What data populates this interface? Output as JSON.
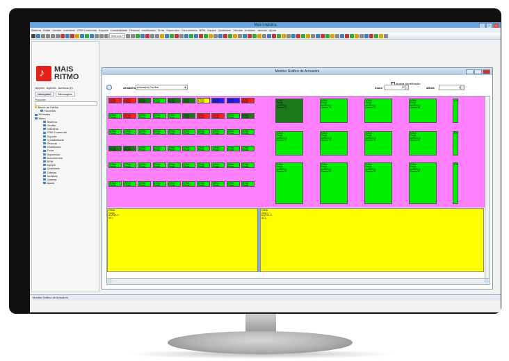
{
  "app": {
    "title": "Mais Logística"
  },
  "menu": [
    "Sistema",
    "Editar",
    "Gestão",
    "Industrial",
    "CRM Comercial",
    "Suporte",
    "Contabilidade",
    "Pessoal",
    "Imobilizado",
    "Frota",
    "Supervisor",
    "Documentos",
    "BPM",
    "Equipe",
    "Qualidade",
    "Tabelas",
    "Análises",
    "Janelas",
    "Ajuda"
  ],
  "toolbar": {
    "date_text": "Ano 2017"
  },
  "brand": {
    "line1": "MAIS",
    "line2": "RITMO",
    "red": "#e32119"
  },
  "leftpanel": {
    "tabs_top": [
      "Opções",
      "Agenda",
      "Acessos (0)"
    ],
    "tabs_bottom": [
      "Navegador",
      "Mensagens"
    ],
    "search_label": "Procurar :",
    "tree": [
      {
        "label": "Bases de Dados",
        "level": 1,
        "icon": "star-icon"
      },
      {
        "label": "Favoritos",
        "level": 2,
        "icon": "folder-icon"
      },
      {
        "label": "Recentes",
        "level": 1,
        "icon": "folder-icon"
      },
      {
        "label": "Menu",
        "level": 1,
        "icon": "folder-icon"
      },
      {
        "label": "Sistema",
        "level": 3,
        "icon": "folder-icon"
      },
      {
        "label": "Gestão",
        "level": 3,
        "icon": "folder-icon"
      },
      {
        "label": "Industrial",
        "level": 3,
        "icon": "folder-icon"
      },
      {
        "label": "CRM Comercial",
        "level": 3,
        "icon": "folder-icon"
      },
      {
        "label": "Suporte",
        "level": 3,
        "icon": "folder-icon"
      },
      {
        "label": "Contabilidade",
        "level": 3,
        "icon": "folder-icon"
      },
      {
        "label": "Pessoal",
        "level": 3,
        "icon": "folder-icon"
      },
      {
        "label": "Imobilizado",
        "level": 3,
        "icon": "folder-icon"
      },
      {
        "label": "Frota",
        "level": 3,
        "icon": "folder-icon"
      },
      {
        "label": "Supervisor",
        "level": 3,
        "icon": "folder-icon"
      },
      {
        "label": "Documentos",
        "level": 3,
        "icon": "folder-icon"
      },
      {
        "label": "BPM",
        "level": 3,
        "icon": "folder-icon"
      },
      {
        "label": "Equipe",
        "level": 3,
        "icon": "folder-icon"
      },
      {
        "label": "Qualidade",
        "level": 3,
        "icon": "folder-icon"
      },
      {
        "label": "Tabelas",
        "level": 3,
        "icon": "folder-icon"
      },
      {
        "label": "Análises",
        "level": 3,
        "icon": "folder-icon"
      },
      {
        "label": "Janelas",
        "level": 3,
        "icon": "folder-icon"
      },
      {
        "label": "Ajuda",
        "level": 3,
        "icon": "folder-icon"
      }
    ]
  },
  "monitor": {
    "title": "Monitor Gráfico de Armazém",
    "mostra_label": "Mostra identificação",
    "armazem_label": "Armazém",
    "armazem_value": "Armazém Central",
    "zoom_label": "Zoom",
    "zoom_value": "17",
    "altura_label": "Altura",
    "altura_value": "1",
    "small_cell_lines": [
      "ZONA:",
      "Peças"
    ],
    "large_cells": [
      {
        "lines": [
          "ZONA:",
          "Peças",
          "ALVÉOLO:",
          "Gaveta 71"
        ],
        "color": "#1a7a1a"
      },
      {
        "lines": [
          "ZONA:",
          "Peças",
          "ALVÉOLO:",
          "Gaveta 74"
        ],
        "color": "#00ee00"
      },
      {
        "lines": [
          "ZONA:",
          "Peças",
          "ALVÉOLO:",
          "Gaveta 77"
        ],
        "color": "#00ee00"
      },
      {
        "lines": [
          "ZONA:",
          "Peças",
          "ALVÉOLO:",
          "Gaveta 80"
        ],
        "color": "#00ee00"
      },
      {
        "lines": [
          "ZONA:",
          "Peças",
          "ALVÉOLO:",
          "Gaveta 72"
        ],
        "color": "#00ee00"
      },
      {
        "lines": [
          "ZONA:",
          "Peças",
          "ALVÉOLO:",
          "Gaveta 75"
        ],
        "color": "#00ee00"
      },
      {
        "lines": [
          "ZONA:",
          "Peças",
          "ALVÉOLO:",
          "Gaveta 78"
        ],
        "color": "#00ee00"
      },
      {
        "lines": [
          "ZONA:",
          "Peças",
          "ALVÉOLO:",
          "Gaveta 81"
        ],
        "color": "#00ee00"
      },
      {
        "lines": [
          "ZONA:",
          "Peças",
          "ALVÉOLO:",
          "Gaveta 73"
        ],
        "color": "#00ee00"
      },
      {
        "lines": [
          "ZONA:",
          "Peças",
          "ALVÉOLO:",
          "Gaveta 76"
        ],
        "color": "#00ee00"
      },
      {
        "lines": [
          "ZONA:",
          "Peças",
          "ALVÉOLO:",
          "Gaveta 79"
        ],
        "color": "#00ee00"
      },
      {
        "lines": [
          "ZONA:",
          "Peças",
          "ALVÉOLO:",
          "Gaveta 82"
        ],
        "color": "#00ee00"
      }
    ],
    "yellow_left": [
      "ZONA:",
      "Carga",
      "ALVÉOLO:",
      "A3-1"
    ],
    "yellow_right": [
      "ZONA:",
      "Zona 1",
      "ALVÉOLO:",
      "A3-1"
    ],
    "colors": {
      "pink": "#ff80ff",
      "green": "#00ee00",
      "dark_green": "#1a7a1a",
      "red": "#ff2020",
      "blue": "#2020ff",
      "yellow": "#ffff00"
    }
  },
  "taskbar": {
    "item": "Monitor Gráfico de Armazém"
  }
}
